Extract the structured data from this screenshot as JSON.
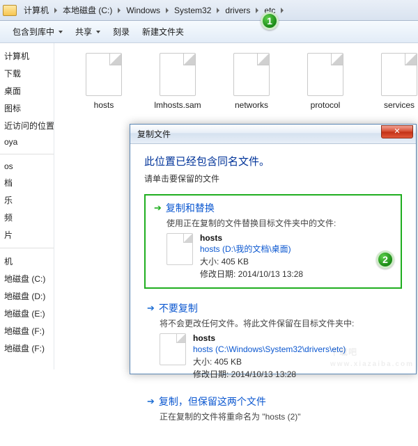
{
  "address": {
    "root": "计算机",
    "parts": [
      "本地磁盘 (C:)",
      "Windows",
      "System32",
      "drivers",
      "etc"
    ]
  },
  "toolbar": {
    "include": "包含到库中",
    "share": "共享",
    "burn": "刻录",
    "newfolder": "新建文件夹"
  },
  "sidebar": {
    "items_a": [
      "计算机",
      "下载",
      "桌面",
      "图标",
      "近访问的位置",
      "oya"
    ],
    "items_b": [
      "os",
      "档",
      "乐",
      "频",
      "片"
    ],
    "items_c": [
      "机",
      "地磁盘 (C:)",
      "地磁盘 (D:)",
      "地磁盘 (E:)",
      "地磁盘 (F:)",
      "地磁盘 (F:)"
    ]
  },
  "files": {
    "items": [
      "hosts",
      "lmhosts.sam",
      "networks",
      "protocol",
      "services"
    ]
  },
  "dialog": {
    "title": "复制文件",
    "headline": "此位置已经包含同名文件。",
    "sub": "请单击要保留的文件",
    "opt1": {
      "label": "复制和替换",
      "desc": "使用正在复制的文件替换目标文件夹中的文件:",
      "fname": "hosts",
      "fpath": "hosts (D:\\我的文档\\桌面)",
      "fsize": "大小: 405 KB",
      "fdate": "修改日期: 2014/10/13 13:28"
    },
    "opt2": {
      "label": "不要复制",
      "desc": "将不会更改任何文件。将此文件保留在目标文件夹中:",
      "fname": "hosts",
      "fpath": "hosts (C:\\Windows\\System32\\drivers\\etc)",
      "fsize": "大小: 405 KB",
      "fdate": "修改日期: 2014/10/13 13:28"
    },
    "opt3": {
      "label": "复制，但保留这两个文件",
      "desc": "正在复制的文件将重命名为 \"hosts (2)\""
    }
  },
  "badges": {
    "one": "1",
    "two": "2"
  },
  "watermark": {
    "big": "下载吧",
    "small": "www.xiazaiba.com"
  }
}
